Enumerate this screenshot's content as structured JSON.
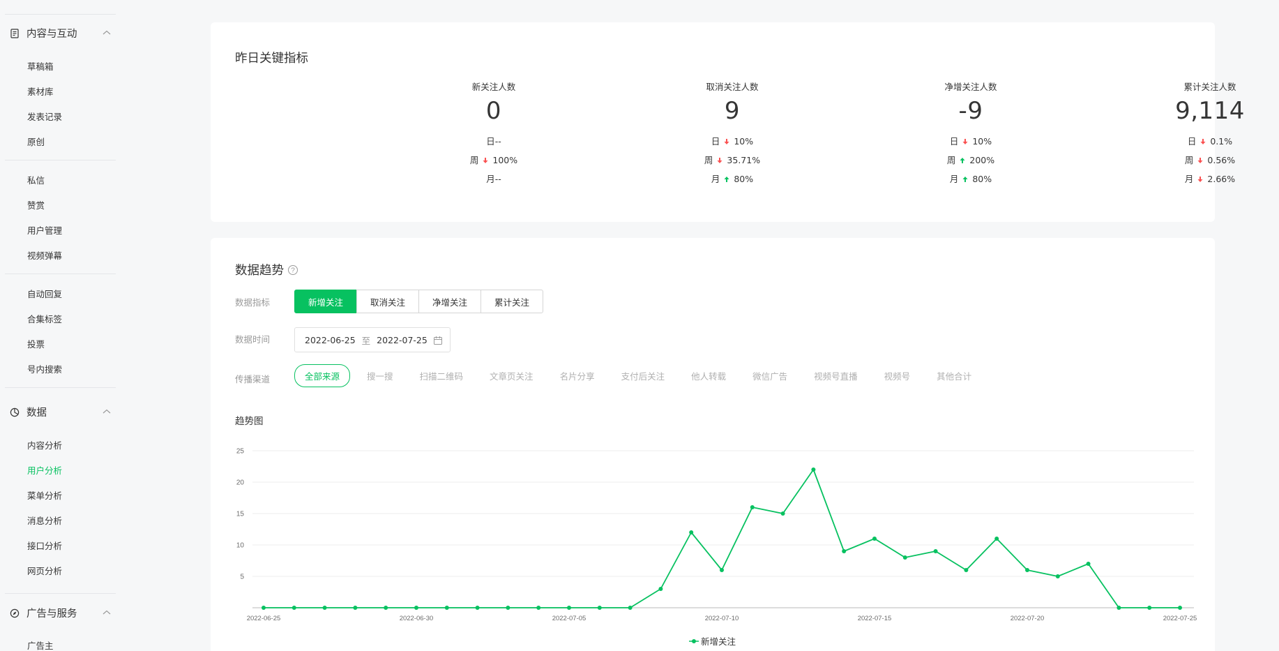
{
  "sidebar": {
    "content": {
      "title": "内容与互动",
      "items": [
        "草稿箱",
        "素材库",
        "发表记录",
        "原创",
        "私信",
        "赞赏",
        "用户管理",
        "视频弹幕",
        "自动回复",
        "合集标签",
        "投票",
        "号内搜索"
      ]
    },
    "data": {
      "title": "数据",
      "items": [
        "内容分析",
        "用户分析",
        "菜单分析",
        "消息分析",
        "接口分析",
        "网页分析"
      ],
      "active": "用户分析"
    },
    "ads": {
      "title": "广告与服务",
      "items": [
        "广告主"
      ]
    }
  },
  "key_metrics": {
    "title": "昨日关键指标",
    "metrics": [
      {
        "label": "新关注人数",
        "value": "0",
        "rows": [
          {
            "period": "日",
            "dir": "none",
            "pct": "--"
          },
          {
            "period": "周",
            "dir": "down",
            "pct": "100%"
          },
          {
            "period": "月",
            "dir": "none",
            "pct": "--"
          }
        ]
      },
      {
        "label": "取消关注人数",
        "value": "9",
        "rows": [
          {
            "period": "日",
            "dir": "down",
            "pct": "10%"
          },
          {
            "period": "周",
            "dir": "down",
            "pct": "35.71%"
          },
          {
            "period": "月",
            "dir": "up",
            "pct": "80%"
          }
        ]
      },
      {
        "label": "净增关注人数",
        "value": "-9",
        "rows": [
          {
            "period": "日",
            "dir": "down",
            "pct": "10%"
          },
          {
            "period": "周",
            "dir": "up",
            "pct": "200%"
          },
          {
            "period": "月",
            "dir": "up",
            "pct": "80%"
          }
        ]
      },
      {
        "label": "累计关注人数",
        "value": "9,114",
        "rows": [
          {
            "period": "日",
            "dir": "down",
            "pct": "0.1%"
          },
          {
            "period": "周",
            "dir": "down",
            "pct": "0.56%"
          },
          {
            "period": "月",
            "dir": "down",
            "pct": "2.66%"
          }
        ]
      }
    ]
  },
  "trend": {
    "title": "数据趋势",
    "metric_label": "数据指标",
    "metric_tabs": [
      "新增关注",
      "取消关注",
      "净增关注",
      "累计关注"
    ],
    "metric_selected": "新增关注",
    "time_label": "数据时间",
    "date_start": "2022-06-25",
    "date_sep": "至",
    "date_end": "2022-07-25",
    "channel_label": "传播渠道",
    "channels": [
      "全部来源",
      "搜一搜",
      "扫描二维码",
      "文章页关注",
      "名片分享",
      "支付后关注",
      "他人转载",
      "微信广告",
      "视频号直播",
      "视频号",
      "其他合计"
    ],
    "channel_selected": "全部来源",
    "chart_title": "趋势图",
    "legend": "新增关注"
  },
  "colors": {
    "accent": "#07c160",
    "down": "#fa5151",
    "up": "#07c160"
  },
  "chart_data": {
    "type": "line",
    "title": "趋势图",
    "x": [
      "2022-06-25",
      "2022-06-26",
      "2022-06-27",
      "2022-06-28",
      "2022-06-29",
      "2022-06-30",
      "2022-07-01",
      "2022-07-02",
      "2022-07-03",
      "2022-07-04",
      "2022-07-05",
      "2022-07-06",
      "2022-07-07",
      "2022-07-08",
      "2022-07-09",
      "2022-07-10",
      "2022-07-11",
      "2022-07-12",
      "2022-07-13",
      "2022-07-14",
      "2022-07-15",
      "2022-07-16",
      "2022-07-17",
      "2022-07-18",
      "2022-07-19",
      "2022-07-20",
      "2022-07-21",
      "2022-07-22",
      "2022-07-23",
      "2022-07-24",
      "2022-07-25"
    ],
    "x_tick_labels": [
      "2022-06-25",
      "2022-06-30",
      "2022-07-05",
      "2022-07-10",
      "2022-07-15",
      "2022-07-20",
      "2022-07-25"
    ],
    "y_ticks": [
      5,
      10,
      15,
      20,
      25
    ],
    "ylim": [
      0,
      25
    ],
    "grid": true,
    "legend_position": "bottom-center",
    "series": [
      {
        "name": "新增关注",
        "color": "#07c160",
        "values": [
          0,
          0,
          0,
          0,
          0,
          0,
          0,
          0,
          0,
          0,
          0,
          0,
          0,
          3,
          12,
          6,
          16,
          15,
          22,
          9,
          11,
          8,
          9,
          6,
          11,
          6,
          5,
          7,
          0,
          0,
          0
        ]
      }
    ]
  }
}
